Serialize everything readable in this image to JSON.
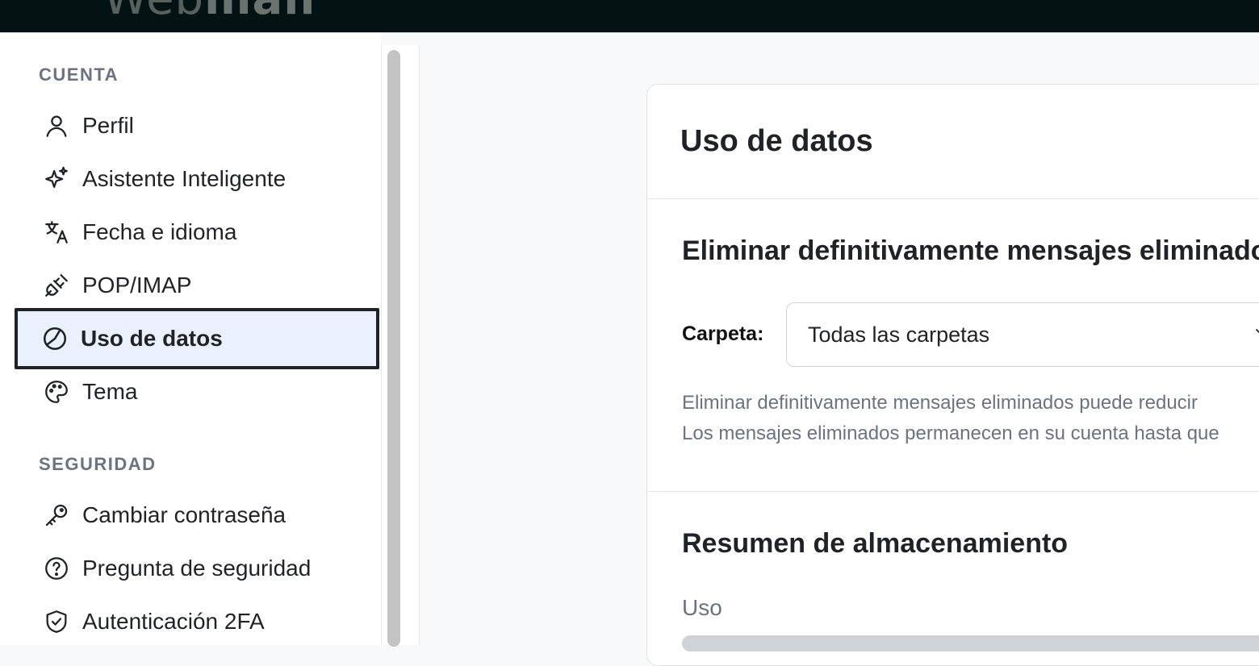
{
  "topbar": {
    "logo_light": "Web",
    "logo_bold": "mail"
  },
  "sidebar": {
    "sections": [
      {
        "title": "CUENTA",
        "items": [
          {
            "label": "Perfil",
            "icon": "user-icon"
          },
          {
            "label": "Asistente Inteligente",
            "icon": "sparkles-icon"
          },
          {
            "label": "Fecha e idioma",
            "icon": "translate-icon"
          },
          {
            "label": "POP/IMAP",
            "icon": "plug-icon"
          },
          {
            "label": "Uso de datos",
            "icon": "pie-chart-icon",
            "active": true
          },
          {
            "label": "Tema",
            "icon": "palette-icon"
          }
        ]
      },
      {
        "title": "SEGURIDAD",
        "items": [
          {
            "label": "Cambiar contraseña",
            "icon": "key-icon"
          },
          {
            "label": "Pregunta de seguridad",
            "icon": "question-circle-icon"
          },
          {
            "label": "Autenticación 2FA",
            "icon": "shield-check-icon"
          }
        ]
      }
    ]
  },
  "main": {
    "title": "Uso de datos",
    "purge": {
      "heading": "Eliminar definitivamente mensajes eliminados",
      "folder_label": "Carpeta:",
      "folder_value": "Todas las carpetas",
      "help_line1": "Eliminar definitivamente mensajes eliminados puede reducir",
      "help_line2": "Los mensajes eliminados permanecen en su cuenta hasta que"
    },
    "storage": {
      "heading": "Resumen de almacenamiento",
      "usage_label": "Uso"
    }
  },
  "colors": {
    "topbar_bg": "#031313",
    "active_item_bg": "#eaf1fc",
    "muted_text": "#6b7280"
  }
}
